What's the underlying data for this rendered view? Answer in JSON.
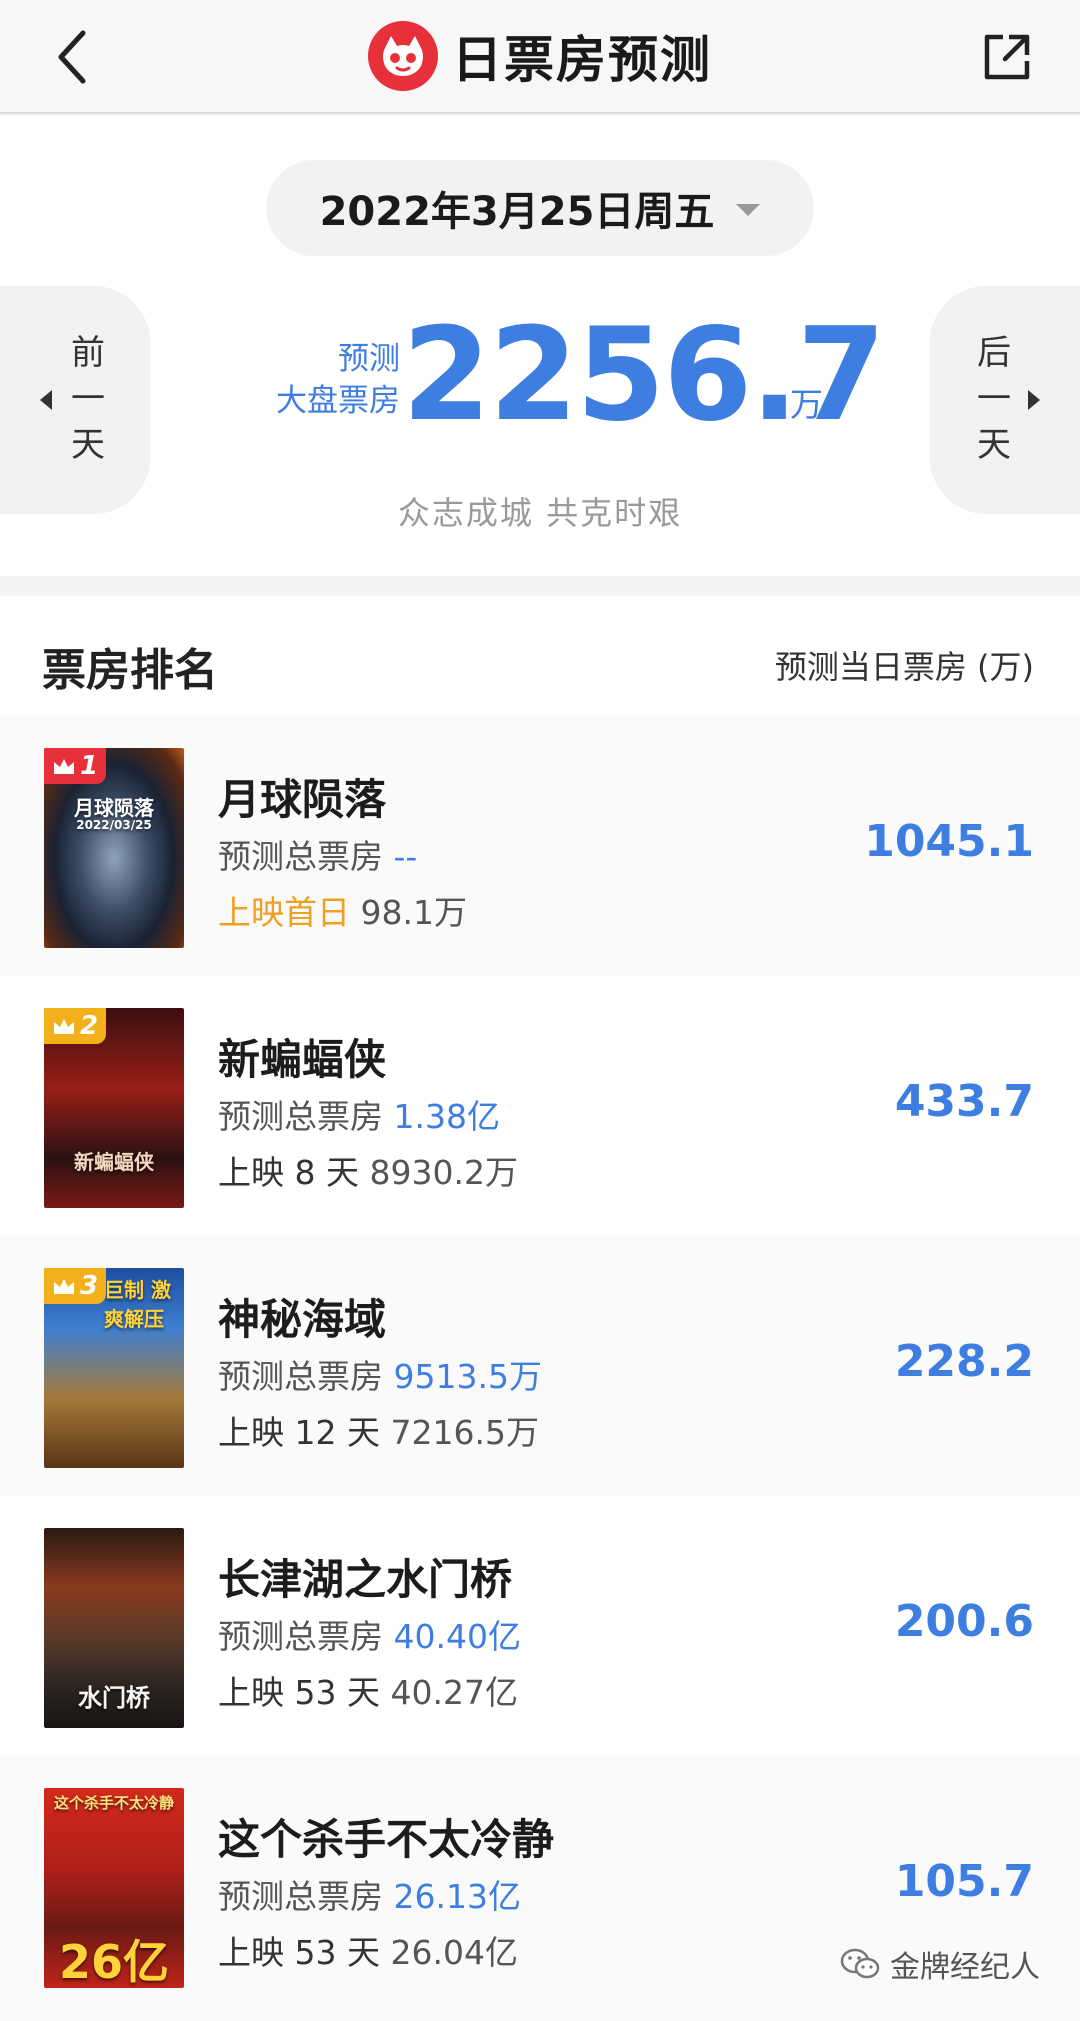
{
  "nav": {
    "title": "日票房预测",
    "back_icon": "chevron-left-icon",
    "share_icon": "share-icon"
  },
  "header": {
    "date": "2022年3月25日周五",
    "prev_label": "前一天",
    "next_label": "后一天",
    "forecast_label_1": "预测",
    "forecast_label_2": "大盘票房",
    "forecast_value": "2256.7",
    "forecast_unit": "万",
    "slogan": "众志成城 共克时艰"
  },
  "ranking": {
    "title": "票房排名",
    "column_label": "预测当日票房 (万)",
    "total_label": "预测总票房",
    "movies": [
      {
        "rank": "1",
        "name": "月球陨落",
        "total": "--",
        "release": "上映首日",
        "cumulative": "98.1万",
        "forecast": "1045.1",
        "poster_title": "月球陨落",
        "poster_date": "2022/03/25"
      },
      {
        "rank": "2",
        "name": "新蝙蝠侠",
        "total": "1.38亿",
        "release": "上映 8 天",
        "cumulative": "8930.2万",
        "forecast": "433.7",
        "poster_title": "新蝙蝠侠"
      },
      {
        "rank": "3",
        "name": "神秘海域",
        "total": "9513.5万",
        "release": "上映 12 天",
        "cumulative": "7216.5万",
        "forecast": "228.2",
        "poster_title": "巨制 激爽解压"
      },
      {
        "rank": "",
        "name": "长津湖之水门桥",
        "total": "40.40亿",
        "release": "上映 53 天",
        "cumulative": "40.27亿",
        "forecast": "200.6",
        "poster_title": "水门桥"
      },
      {
        "rank": "",
        "name": "这个杀手不太冷静",
        "total": "26.13亿",
        "release": "上映 53 天",
        "cumulative": "26.04亿",
        "forecast": "105.7",
        "poster_title": "这个杀手不太冷静",
        "poster_big": "26亿"
      }
    ]
  },
  "watermark": "金牌经纪人",
  "colors": {
    "accent": "#3d7ee0",
    "brand_red": "#e8303a",
    "orange": "#f0a020",
    "gold": "#f2b11b"
  }
}
